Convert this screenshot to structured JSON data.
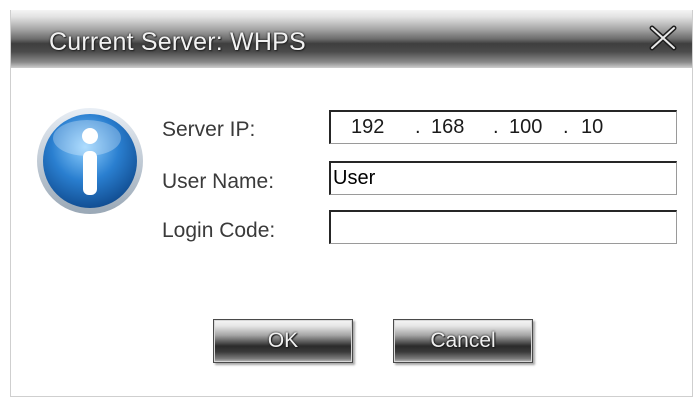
{
  "dialog": {
    "title": "Current Server: WHPS",
    "close_glyph": "X"
  },
  "icon": {
    "name": "info-icon",
    "color": "#2a7fd0"
  },
  "form": {
    "server_ip_label": "Server IP:",
    "user_name_label": "User Name:",
    "login_code_label": "Login Code:",
    "server_ip": {
      "octet1": "192",
      "octet2": "168",
      "octet3": "100",
      "octet4": "10",
      "separator": "."
    },
    "user_name_value": "User",
    "login_code_value": ""
  },
  "buttons": {
    "ok_label": "OK",
    "cancel_label": "Cancel"
  }
}
